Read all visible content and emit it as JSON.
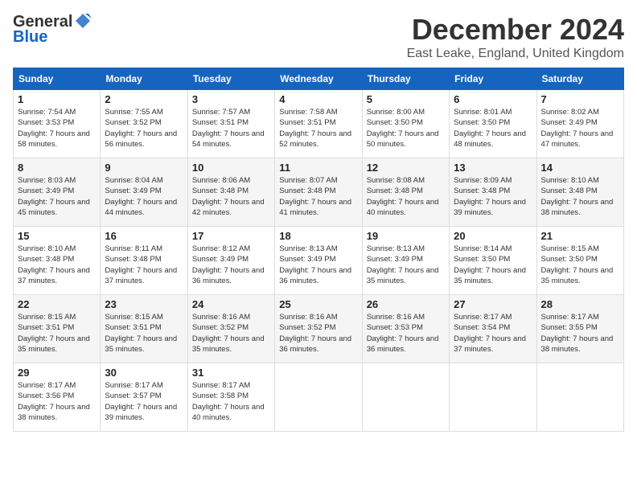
{
  "header": {
    "logo_general": "General",
    "logo_blue": "Blue",
    "month_title": "December 2024",
    "location": "East Leake, England, United Kingdom"
  },
  "calendar": {
    "days_of_week": [
      "Sunday",
      "Monday",
      "Tuesday",
      "Wednesday",
      "Thursday",
      "Friday",
      "Saturday"
    ],
    "weeks": [
      [
        {
          "day": "1",
          "sunrise": "7:54 AM",
          "sunset": "3:53 PM",
          "daylight": "7 hours and 58 minutes."
        },
        {
          "day": "2",
          "sunrise": "7:55 AM",
          "sunset": "3:52 PM",
          "daylight": "7 hours and 56 minutes."
        },
        {
          "day": "3",
          "sunrise": "7:57 AM",
          "sunset": "3:51 PM",
          "daylight": "7 hours and 54 minutes."
        },
        {
          "day": "4",
          "sunrise": "7:58 AM",
          "sunset": "3:51 PM",
          "daylight": "7 hours and 52 minutes."
        },
        {
          "day": "5",
          "sunrise": "8:00 AM",
          "sunset": "3:50 PM",
          "daylight": "7 hours and 50 minutes."
        },
        {
          "day": "6",
          "sunrise": "8:01 AM",
          "sunset": "3:50 PM",
          "daylight": "7 hours and 48 minutes."
        },
        {
          "day": "7",
          "sunrise": "8:02 AM",
          "sunset": "3:49 PM",
          "daylight": "7 hours and 47 minutes."
        }
      ],
      [
        {
          "day": "8",
          "sunrise": "8:03 AM",
          "sunset": "3:49 PM",
          "daylight": "7 hours and 45 minutes."
        },
        {
          "day": "9",
          "sunrise": "8:04 AM",
          "sunset": "3:49 PM",
          "daylight": "7 hours and 44 minutes."
        },
        {
          "day": "10",
          "sunrise": "8:06 AM",
          "sunset": "3:48 PM",
          "daylight": "7 hours and 42 minutes."
        },
        {
          "day": "11",
          "sunrise": "8:07 AM",
          "sunset": "3:48 PM",
          "daylight": "7 hours and 41 minutes."
        },
        {
          "day": "12",
          "sunrise": "8:08 AM",
          "sunset": "3:48 PM",
          "daylight": "7 hours and 40 minutes."
        },
        {
          "day": "13",
          "sunrise": "8:09 AM",
          "sunset": "3:48 PM",
          "daylight": "7 hours and 39 minutes."
        },
        {
          "day": "14",
          "sunrise": "8:10 AM",
          "sunset": "3:48 PM",
          "daylight": "7 hours and 38 minutes."
        }
      ],
      [
        {
          "day": "15",
          "sunrise": "8:10 AM",
          "sunset": "3:48 PM",
          "daylight": "7 hours and 37 minutes."
        },
        {
          "day": "16",
          "sunrise": "8:11 AM",
          "sunset": "3:48 PM",
          "daylight": "7 hours and 37 minutes."
        },
        {
          "day": "17",
          "sunrise": "8:12 AM",
          "sunset": "3:49 PM",
          "daylight": "7 hours and 36 minutes."
        },
        {
          "day": "18",
          "sunrise": "8:13 AM",
          "sunset": "3:49 PM",
          "daylight": "7 hours and 36 minutes."
        },
        {
          "day": "19",
          "sunrise": "8:13 AM",
          "sunset": "3:49 PM",
          "daylight": "7 hours and 35 minutes."
        },
        {
          "day": "20",
          "sunrise": "8:14 AM",
          "sunset": "3:50 PM",
          "daylight": "7 hours and 35 minutes."
        },
        {
          "day": "21",
          "sunrise": "8:15 AM",
          "sunset": "3:50 PM",
          "daylight": "7 hours and 35 minutes."
        }
      ],
      [
        {
          "day": "22",
          "sunrise": "8:15 AM",
          "sunset": "3:51 PM",
          "daylight": "7 hours and 35 minutes."
        },
        {
          "day": "23",
          "sunrise": "8:15 AM",
          "sunset": "3:51 PM",
          "daylight": "7 hours and 35 minutes."
        },
        {
          "day": "24",
          "sunrise": "8:16 AM",
          "sunset": "3:52 PM",
          "daylight": "7 hours and 35 minutes."
        },
        {
          "day": "25",
          "sunrise": "8:16 AM",
          "sunset": "3:52 PM",
          "daylight": "7 hours and 36 minutes."
        },
        {
          "day": "26",
          "sunrise": "8:16 AM",
          "sunset": "3:53 PM",
          "daylight": "7 hours and 36 minutes."
        },
        {
          "day": "27",
          "sunrise": "8:17 AM",
          "sunset": "3:54 PM",
          "daylight": "7 hours and 37 minutes."
        },
        {
          "day": "28",
          "sunrise": "8:17 AM",
          "sunset": "3:55 PM",
          "daylight": "7 hours and 38 minutes."
        }
      ],
      [
        {
          "day": "29",
          "sunrise": "8:17 AM",
          "sunset": "3:56 PM",
          "daylight": "7 hours and 38 minutes."
        },
        {
          "day": "30",
          "sunrise": "8:17 AM",
          "sunset": "3:57 PM",
          "daylight": "7 hours and 39 minutes."
        },
        {
          "day": "31",
          "sunrise": "8:17 AM",
          "sunset": "3:58 PM",
          "daylight": "7 hours and 40 minutes."
        },
        null,
        null,
        null,
        null
      ]
    ]
  }
}
